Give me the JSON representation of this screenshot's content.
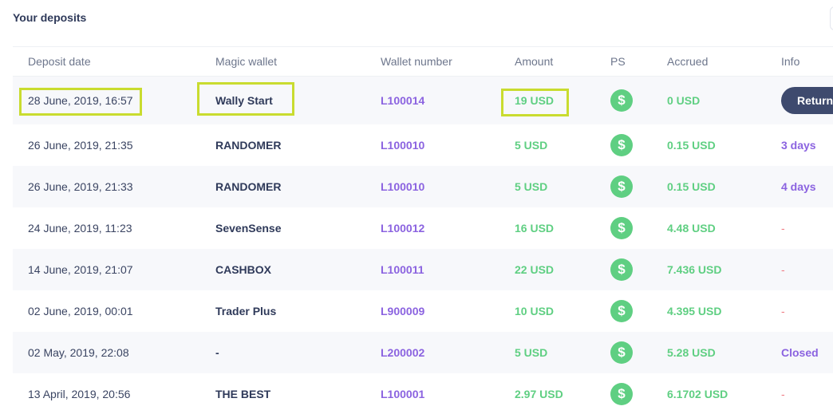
{
  "title": "Your deposits",
  "columns": {
    "date": "Deposit date",
    "wallet": "Magic wallet",
    "number": "Wallet number",
    "amount": "Amount",
    "ps": "PS",
    "accrued": "Accrued",
    "info": "Info"
  },
  "ps_icon": "dollar-icon",
  "ps_glyph": "$",
  "colors": {
    "accent_green": "#5fcf82",
    "accent_purple": "#8b63e0",
    "highlight": "#c9dc2f",
    "button_dark": "#3e4a6e"
  },
  "rows": [
    {
      "date": "28 June, 2019, 16:57",
      "wallet": "Wally Start",
      "number": "L100014",
      "amount": "19 USD",
      "accrued": "0 USD",
      "info": "Return",
      "info_type": "button"
    },
    {
      "date": "26 June, 2019, 21:35",
      "wallet": "RANDOMER",
      "number": "L100010",
      "amount": "5 USD",
      "accrued": "0.15 USD",
      "info": "3 days",
      "info_type": "days"
    },
    {
      "date": "26 June, 2019, 21:33",
      "wallet": "RANDOMER",
      "number": "L100010",
      "amount": "5 USD",
      "accrued": "0.15 USD",
      "info": "4 days",
      "info_type": "days"
    },
    {
      "date": "24 June, 2019, 11:23",
      "wallet": "SevenSense",
      "number": "L100012",
      "amount": "16 USD",
      "accrued": "4.48 USD",
      "info": "-",
      "info_type": "dash"
    },
    {
      "date": "14 June, 2019, 21:07",
      "wallet": "CASHBOX",
      "number": "L100011",
      "amount": "22 USD",
      "accrued": "7.436 USD",
      "info": "-",
      "info_type": "dash"
    },
    {
      "date": "02 June, 2019, 00:01",
      "wallet": "Trader Plus",
      "number": "L900009",
      "amount": "10 USD",
      "accrued": "4.395 USD",
      "info": "-",
      "info_type": "dash"
    },
    {
      "date": "02 May, 2019, 22:08",
      "wallet": "-",
      "number": "L200002",
      "amount": "5 USD",
      "accrued": "5.28 USD",
      "info": "Closed",
      "info_type": "closed"
    },
    {
      "date": "13 April, 2019, 20:56",
      "wallet": "THE BEST",
      "number": "L100001",
      "amount": "2.97 USD",
      "accrued": "6.1702 USD",
      "info": "-",
      "info_type": "dash"
    }
  ]
}
